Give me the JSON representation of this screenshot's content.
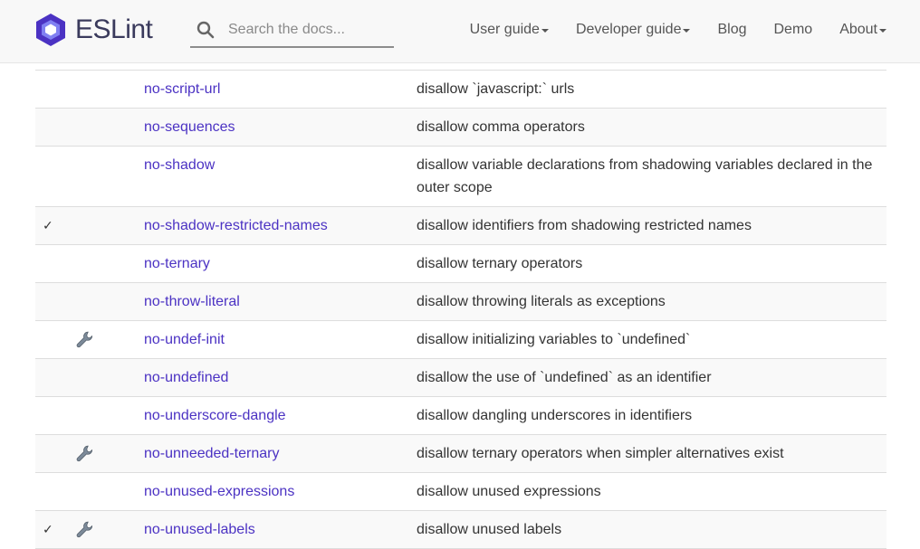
{
  "brand": {
    "name": "ESLint",
    "logo_color": "#4b32c3"
  },
  "search": {
    "placeholder": "Search the docs..."
  },
  "nav": [
    {
      "label": "User guide",
      "dropdown": true
    },
    {
      "label": "Developer guide",
      "dropdown": true
    },
    {
      "label": "Blog",
      "dropdown": false
    },
    {
      "label": "Demo",
      "dropdown": false
    },
    {
      "label": "About",
      "dropdown": true
    }
  ],
  "rules": [
    {
      "name": "no-script-url",
      "description": "disallow `javascript:` urls",
      "recommended": false,
      "fixable": false
    },
    {
      "name": "no-sequences",
      "description": "disallow comma operators",
      "recommended": false,
      "fixable": false
    },
    {
      "name": "no-shadow",
      "description": "disallow variable declarations from shadowing variables declared in the outer scope",
      "recommended": false,
      "fixable": false
    },
    {
      "name": "no-shadow-restricted-names",
      "description": "disallow identifiers from shadowing restricted names",
      "recommended": true,
      "fixable": false
    },
    {
      "name": "no-ternary",
      "description": "disallow ternary operators",
      "recommended": false,
      "fixable": false
    },
    {
      "name": "no-throw-literal",
      "description": "disallow throwing literals as exceptions",
      "recommended": false,
      "fixable": false
    },
    {
      "name": "no-undef-init",
      "description": "disallow initializing variables to `undefined`",
      "recommended": false,
      "fixable": true
    },
    {
      "name": "no-undefined",
      "description": "disallow the use of `undefined` as an identifier",
      "recommended": false,
      "fixable": false
    },
    {
      "name": "no-underscore-dangle",
      "description": "disallow dangling underscores in identifiers",
      "recommended": false,
      "fixable": false
    },
    {
      "name": "no-unneeded-ternary",
      "description": "disallow ternary operators when simpler alternatives exist",
      "recommended": false,
      "fixable": true
    },
    {
      "name": "no-unused-expressions",
      "description": "disallow unused expressions",
      "recommended": false,
      "fixable": false
    },
    {
      "name": "no-unused-labels",
      "description": "disallow unused labels",
      "recommended": true,
      "fixable": true
    }
  ],
  "icons": {
    "recommended": "check-mark",
    "fixable": "wrench-icon"
  },
  "check_glyph": "✓"
}
